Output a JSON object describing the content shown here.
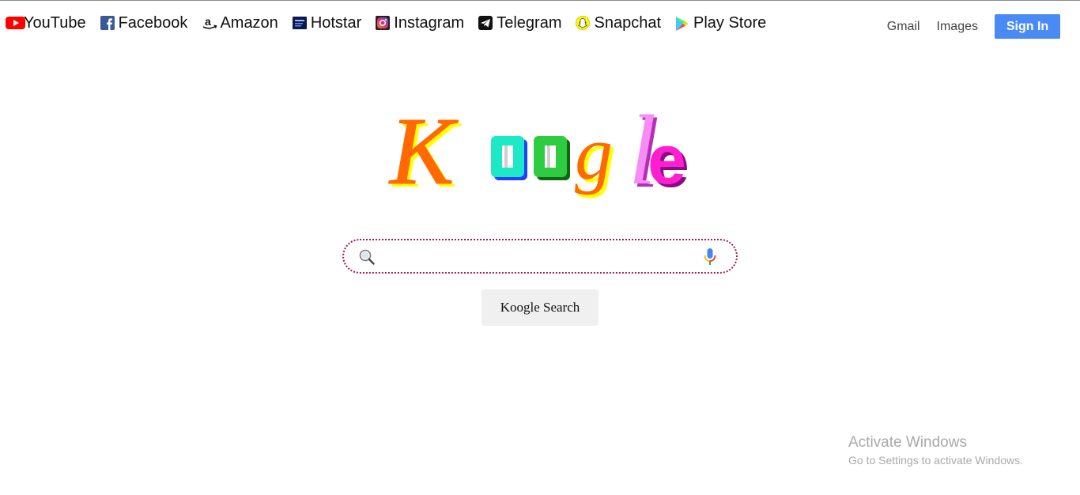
{
  "shortcuts": [
    {
      "label": "YouTube",
      "icon": "youtube-icon"
    },
    {
      "label": "Facebook",
      "icon": "facebook-icon"
    },
    {
      "label": "Amazon",
      "icon": "amazon-icon"
    },
    {
      "label": "Hotstar",
      "icon": "hotstar-icon"
    },
    {
      "label": "Instagram",
      "icon": "instagram-icon"
    },
    {
      "label": "Telegram",
      "icon": "telegram-icon"
    },
    {
      "label": "Snapchat",
      "icon": "snapchat-icon"
    },
    {
      "label": "Play Store",
      "icon": "play-store-icon"
    }
  ],
  "nav": {
    "gmail": "Gmail",
    "images": "Images",
    "sign_in": "Sign In"
  },
  "logo": {
    "text": "Koogle",
    "colors": {
      "k": "#ff6a00",
      "o1": "#1de9c6",
      "o2": "#2ecc40",
      "g": "#ff6a00",
      "l": "#f78cf7",
      "e": "#ff1fd1",
      "shadow_yellow": "#ffff00"
    }
  },
  "search": {
    "placeholder": "",
    "value": "",
    "border_color": "#a3195b",
    "button_label": "Koogle Search"
  },
  "watermark": {
    "title": "Activate Windows",
    "subtitle": "Go to Settings to activate Windows."
  },
  "colors": {
    "sign_in_bg": "#4a8af4"
  }
}
